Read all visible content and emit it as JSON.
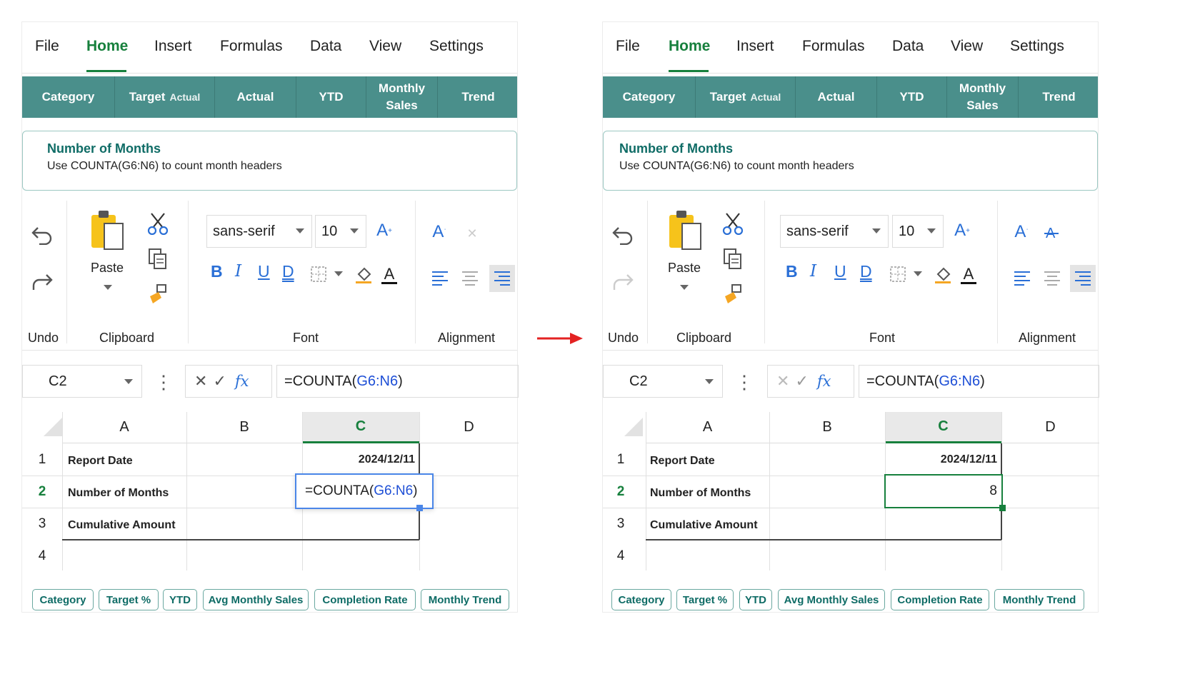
{
  "menu": [
    "File",
    "Home",
    "Insert",
    "Formulas",
    "Data",
    "View",
    "Settings"
  ],
  "header_cells": {
    "category": "Category",
    "target": "Target",
    "target_overlap": "Actual",
    "actual": "Actual",
    "ytd": "YTD",
    "monthly_line1": "Monthly",
    "monthly_line2": "Sales",
    "trend": "Trend"
  },
  "note": {
    "title": "Number of Months",
    "desc": "Use COUNTA(G6:N6) to count month headers"
  },
  "ribbon": {
    "paste_label": "Paste",
    "font_name": "sans-serif",
    "font_size": "10",
    "groups": {
      "undo": "Undo",
      "clipboard": "Clipboard",
      "font": "Font",
      "alignment": "Alignment"
    }
  },
  "formula_bar": {
    "cell_ref": "C2",
    "formula_prefix": "=COUNTA(",
    "formula_ref": "G6:N6",
    "formula_suffix": ")"
  },
  "grid": {
    "columns": [
      "A",
      "B",
      "C",
      "D"
    ],
    "rows": [
      "1",
      "2",
      "3",
      "4"
    ],
    "a1": "Report Date",
    "a2": "Number of Months",
    "a3": "Cumulative Amount",
    "c1": "2024/12/11",
    "c2_before_prefix": "=COUNTA(",
    "c2_before_ref": "G6:N6",
    "c2_before_suffix": ")",
    "c2_after": "8"
  },
  "bottom_tabs": [
    "Category",
    "Target %",
    "YTD",
    "Avg Monthly Sales",
    "Completion Rate",
    "Monthly Trend"
  ],
  "colors": {
    "accent": "#17803d",
    "header": "#4a8f8b",
    "note_title": "#0f6c66",
    "arrow": "#e32222",
    "ref": "#1e4fd6"
  }
}
